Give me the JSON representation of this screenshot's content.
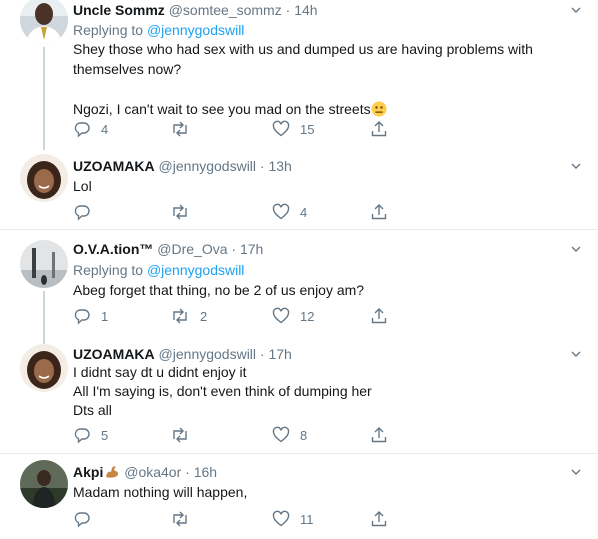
{
  "tweets": [
    {
      "display_name": "Uncle Sommz",
      "handle": "@somtee_sommz",
      "time": "14h",
      "replying_prefix": "Replying to",
      "replying_to": "@jennygodswill",
      "lines": [
        "Shey those who had sex with us and dumped us are having problems with themselves now?",
        "",
        "Ngozi, I can't wait to see you mad on the streets"
      ],
      "emoji": "neutral-face-emoji",
      "replies": "4",
      "retweets": "",
      "likes": "15"
    },
    {
      "display_name": "UZOAMAKA",
      "handle": "@jennygodswill",
      "time": "13h",
      "lines": [
        "Lol"
      ],
      "replies": "",
      "retweets": "",
      "likes": "4"
    },
    {
      "display_name": "O.V.A.tion™",
      "handle": "@Dre_Ova",
      "time": "17h",
      "replying_prefix": "Replying to",
      "replying_to": "@jennygodswill",
      "lines": [
        "Abeg forget that thing, no be 2 of us enjoy am?"
      ],
      "replies": "1",
      "retweets": "2",
      "likes": "12"
    },
    {
      "display_name": "UZOAMAKA",
      "handle": "@jennygodswill",
      "time": "17h",
      "lines": [
        "I didnt say dt u didnt enjoy it",
        "All I'm saying is, don't even think of dumping her",
        "Dts all"
      ],
      "replies": "5",
      "retweets": "",
      "likes": "8"
    },
    {
      "display_name": "Akpi",
      "display_name_emoji": "flexed-biceps-emoji",
      "handle": "@oka4or",
      "time": "16h",
      "lines": [
        "Madam nothing will happen,"
      ],
      "replies": "",
      "retweets": "",
      "likes": "11"
    }
  ],
  "separator_dot": "·",
  "colors": {
    "text": "#14171a",
    "muted": "#657786",
    "link": "#1da1f2",
    "divider": "#e6ecf0",
    "thread_line": "#ccd6dd"
  }
}
